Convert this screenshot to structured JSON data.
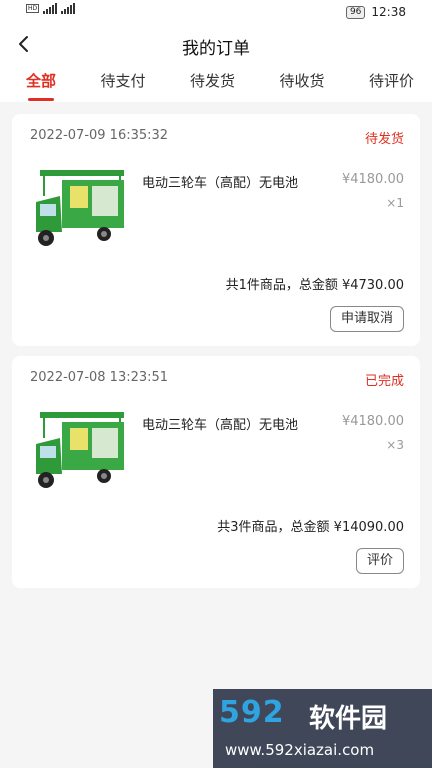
{
  "statusbar": {
    "time": "12:38",
    "battery": "96"
  },
  "header": {
    "title": "我的订单"
  },
  "tabs": [
    {
      "label": "全部",
      "active": true
    },
    {
      "label": "待支付"
    },
    {
      "label": "待发货"
    },
    {
      "label": "待收货"
    },
    {
      "label": "待评价"
    }
  ],
  "orders": [
    {
      "time": "2022-07-09 16:35:32",
      "status": "待发货",
      "product_name": "电动三轮车（高配）无电池",
      "price": "¥4180.00",
      "quantity": "×1",
      "summary": "共1件商品，总金额 ¥4730.00",
      "action": "申请取消"
    },
    {
      "time": "2022-07-08 13:23:51",
      "status": "已完成",
      "product_name": "电动三轮车（高配）无电池",
      "price": "¥4180.00",
      "quantity": "×3",
      "summary": "共3件商品，总金额 ¥14090.00",
      "action": "评价"
    }
  ],
  "watermark": {
    "brand_num": "592",
    "brand_text": "软件园",
    "url": "www.592xiazai.com"
  },
  "colors": {
    "accent": "#e02f22",
    "product_green": "#2f9a3a"
  }
}
